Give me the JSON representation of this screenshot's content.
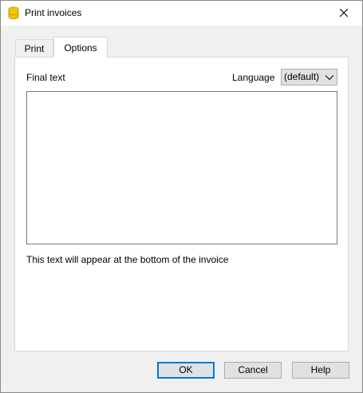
{
  "window": {
    "title": "Print invoices",
    "app_icon": "database-cylinder-icon",
    "accent_color": "#0078d7",
    "icon_color": "#f5c400"
  },
  "tabs": [
    {
      "label": "Print",
      "selected": false
    },
    {
      "label": "Options",
      "selected": true
    }
  ],
  "options": {
    "final_text_label": "Final text",
    "language_label": "Language",
    "language_value": "(default)",
    "final_text_value": "",
    "hint": "This text will appear at the bottom of the invoice"
  },
  "buttons": {
    "ok": "OK",
    "cancel": "Cancel",
    "help": "Help"
  }
}
